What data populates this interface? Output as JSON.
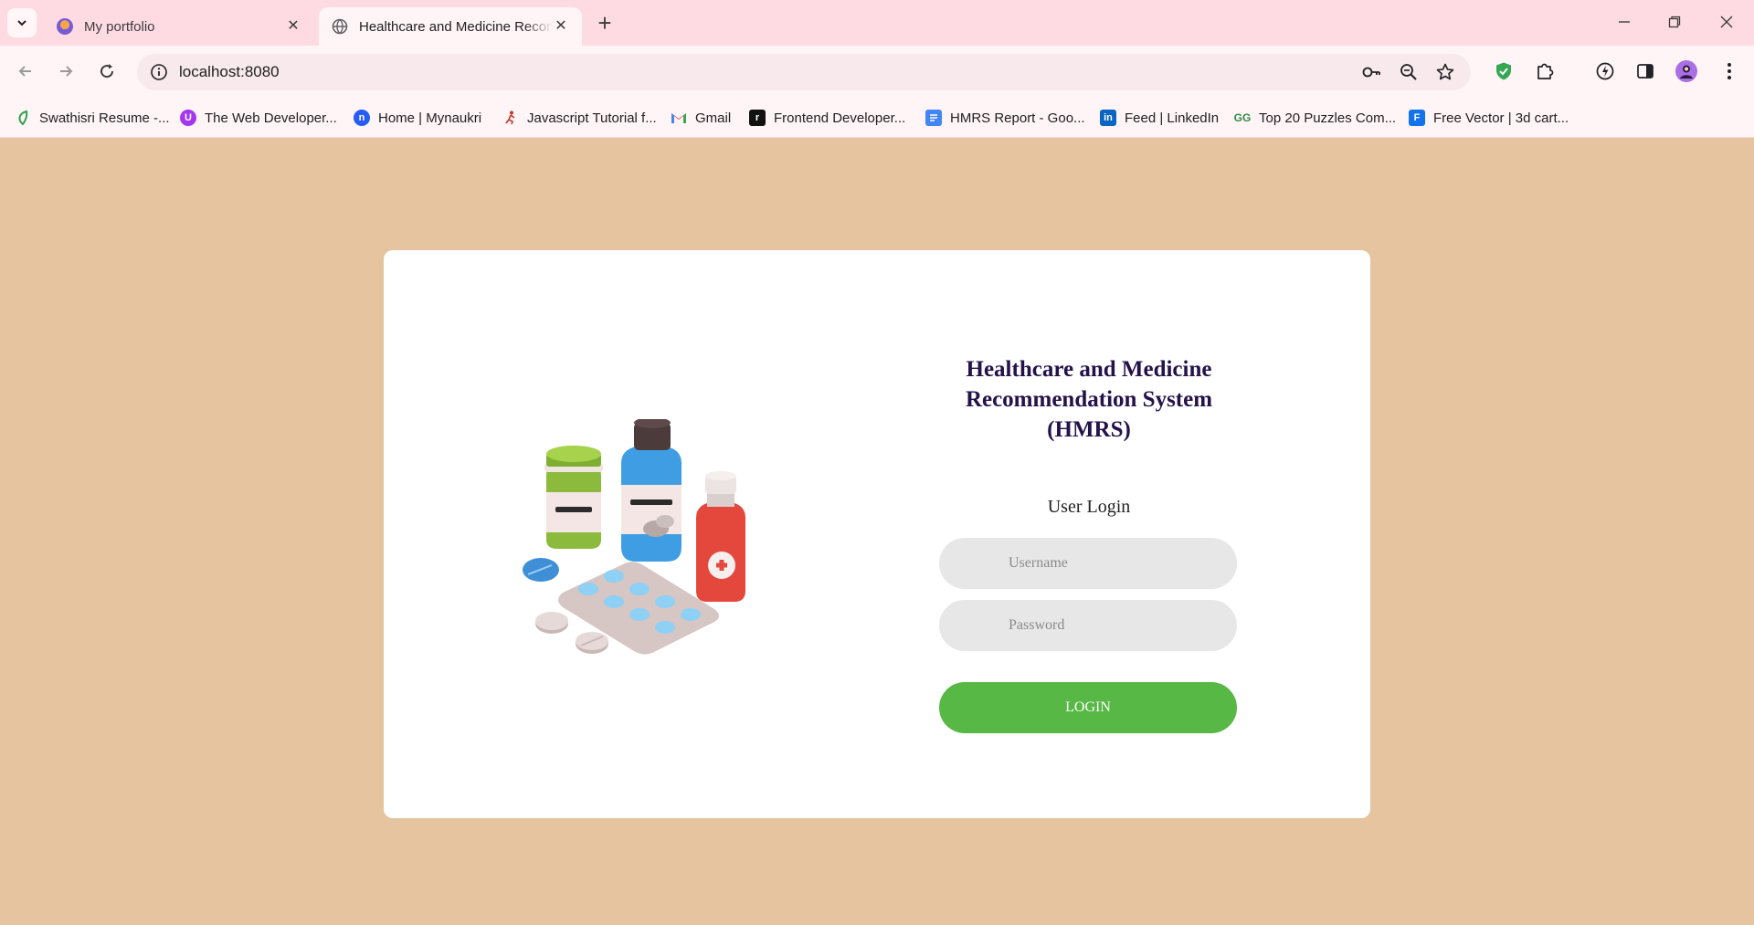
{
  "browser": {
    "tabs": [
      {
        "title": "My portfolio",
        "active": false
      },
      {
        "title": "Healthcare and Medicine Recom",
        "active": true
      }
    ],
    "url": "localhost:8080",
    "bookmarks": [
      {
        "label": "Swathisri Resume -...",
        "icon": "leaf-icon",
        "color": "#2da44e"
      },
      {
        "label": "The Web Developer...",
        "icon": "udemy-icon",
        "color": "#a435f0"
      },
      {
        "label": "Home | Mynaukri",
        "icon": "naukri-icon",
        "color": "#275df5"
      },
      {
        "label": "Javascript Tutorial f...",
        "icon": "runner-icon",
        "color": "#c0392b"
      },
      {
        "label": "Gmail",
        "icon": "gmail-icon",
        "color": "#ea4335"
      },
      {
        "label": "Frontend Developer...",
        "icon": "frontend-icon",
        "color": "#111111"
      },
      {
        "label": "HMRS Report - Goo...",
        "icon": "docs-icon",
        "color": "#4285f4"
      },
      {
        "label": "Feed | LinkedIn",
        "icon": "linkedin-icon",
        "color": "#0a66c2"
      },
      {
        "label": "Top 20 Puzzles Com...",
        "icon": "gfg-icon",
        "color": "#2f8d46"
      },
      {
        "label": "Free Vector | 3d cart...",
        "icon": "freepik-icon",
        "color": "#1273eb"
      }
    ]
  },
  "login": {
    "title_line1": "Healthcare and Medicine",
    "title_line2": "Recommendation System",
    "title_line3": "(HMRS)",
    "subtitle": "User Login",
    "username_placeholder": "Username",
    "password_placeholder": "Password",
    "button_label": "LOGIN"
  },
  "colors": {
    "page_background": "#e5c49f",
    "card_background": "#ffffff",
    "title_color": "#24124a",
    "button_color": "#57b846",
    "field_background": "#e7e7e7"
  }
}
